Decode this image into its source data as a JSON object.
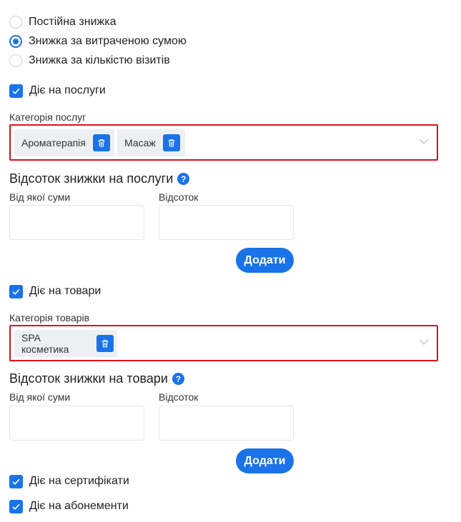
{
  "discount_type": {
    "options": [
      {
        "label": "Постійна знижка",
        "selected": false
      },
      {
        "label": "Знижка за витраченою сумою",
        "selected": true
      },
      {
        "label": "Знижка за кількістю візитів",
        "selected": false
      }
    ]
  },
  "services": {
    "applies_label": "Діє на послуги",
    "applies_checked": true,
    "category_label": "Категорія послуг",
    "chips": [
      "Ароматерапія",
      "Масаж"
    ],
    "percent_heading": "Відсоток знижки на послуги",
    "help_icon": "?",
    "from_sum_label": "Від якої суми",
    "percent_label": "Відсоток",
    "from_sum_value": "",
    "percent_value": "",
    "add_button": "Додати"
  },
  "goods": {
    "applies_label": "Діє на товари",
    "applies_checked": true,
    "category_label": "Категорія товарів",
    "chips": [
      "SPA косметика"
    ],
    "percent_heading": "Відсоток знижки на товари",
    "help_icon": "?",
    "from_sum_label": "Від якої суми",
    "percent_label": "Відсоток",
    "from_sum_value": "",
    "percent_value": "",
    "add_button": "Додати"
  },
  "certificates": {
    "label": "Діє на сертифікати",
    "checked": true
  },
  "subscriptions": {
    "label": "Діє на абонементи",
    "checked": true
  },
  "colors": {
    "accent": "#1a73e8",
    "highlight_border": "#e0101a",
    "chip_bg": "#edf0f3"
  },
  "icons": {
    "chip_remove": "trash-icon",
    "select_open": "chevron-down-icon",
    "checkbox": "checkmark-icon",
    "help": "question-circle-icon"
  }
}
